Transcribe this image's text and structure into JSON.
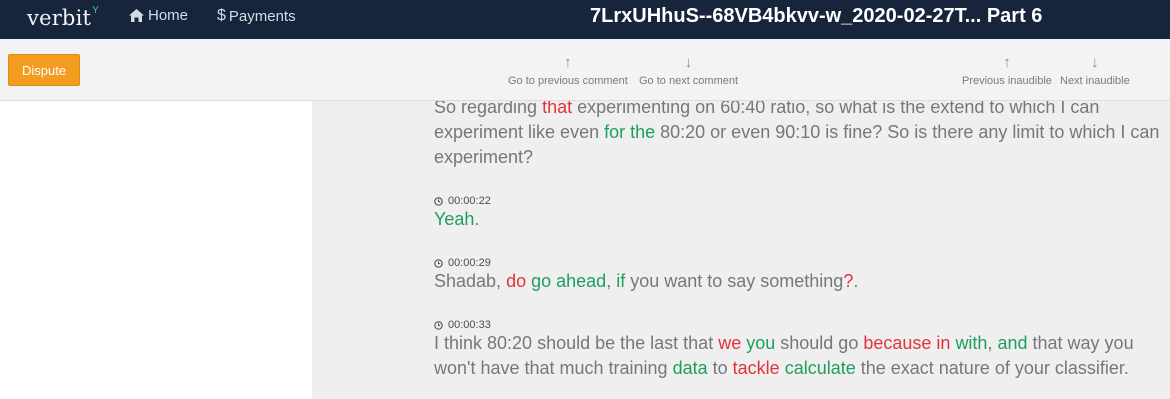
{
  "app": {
    "logo": "verbit",
    "logo_mark": "Y",
    "nav": {
      "home": "Home",
      "payments": "Payments"
    },
    "title": "7LrxUHhuS--68VB4bkvv-w_2020-02-27T... Part 6"
  },
  "toolbar": {
    "dispute": "Dispute",
    "prev_comment": {
      "arrow": "↑",
      "label": "Go to previous comment"
    },
    "next_comment": {
      "arrow": "↓",
      "label": "Go to next comment"
    },
    "prev_inaudible": {
      "arrow": "↑",
      "label": "Previous inaudible"
    },
    "next_inaudible": {
      "arrow": "↓",
      "label": "Next inaudible"
    }
  },
  "colors": {
    "nav_bg": "#16253c",
    "dispute": "#f39c1f",
    "deleted_word": "#e2333b",
    "inserted_word": "#1e9e5c",
    "text": "#777777"
  },
  "segments": [
    {
      "time": "",
      "lines": [
        [
          {
            "t": "So regarding ",
            "s": "n"
          },
          {
            "t": "that",
            "s": "r"
          },
          {
            "t": " experimenting on 60:40 ratio, so what is the extend to which I can",
            "s": "n"
          }
        ],
        [
          {
            "t": "experiment like even ",
            "s": "n"
          },
          {
            "t": "for the",
            "s": "g"
          },
          {
            "t": " 80:20 or even 90:10 is fine? So is there any limit to which I can",
            "s": "n"
          }
        ],
        [
          {
            "t": "experiment?",
            "s": "n"
          }
        ]
      ]
    },
    {
      "time": "00:00:22",
      "lines": [
        [
          {
            "t": "Yeah",
            "s": "g"
          },
          {
            "t": ".",
            "s": "n"
          }
        ]
      ]
    },
    {
      "time": "00:00:29",
      "lines": [
        [
          {
            "t": "Shadab, ",
            "s": "n"
          },
          {
            "t": "do",
            "s": "r"
          },
          {
            "t": " ",
            "s": "n"
          },
          {
            "t": "go ahead",
            "s": "g"
          },
          {
            "t": ", ",
            "s": "n"
          },
          {
            "t": "if",
            "s": "g"
          },
          {
            "t": " you want to say something",
            "s": "n"
          },
          {
            "t": "?",
            "s": "r"
          },
          {
            "t": ".",
            "s": "n"
          }
        ]
      ]
    },
    {
      "time": "00:00:33",
      "lines": [
        [
          {
            "t": "I think 80:20 should be the last that ",
            "s": "n"
          },
          {
            "t": "we",
            "s": "r"
          },
          {
            "t": " ",
            "s": "n"
          },
          {
            "t": "you",
            "s": "g"
          },
          {
            "t": " should go ",
            "s": "n"
          },
          {
            "t": "because in",
            "s": "r"
          },
          {
            "t": " ",
            "s": "n"
          },
          {
            "t": "with",
            "s": "g"
          },
          {
            "t": ", ",
            "s": "n"
          },
          {
            "t": "and",
            "s": "g"
          },
          {
            "t": " that way you",
            "s": "n"
          }
        ],
        [
          {
            "t": "won't have that much training ",
            "s": "n"
          },
          {
            "t": "data",
            "s": "g"
          },
          {
            "t": " to ",
            "s": "n"
          },
          {
            "t": "tackle",
            "s": "r"
          },
          {
            "t": " ",
            "s": "n"
          },
          {
            "t": "calculate",
            "s": "g"
          },
          {
            "t": " the exact nature of your classifier.",
            "s": "n"
          }
        ]
      ]
    }
  ]
}
